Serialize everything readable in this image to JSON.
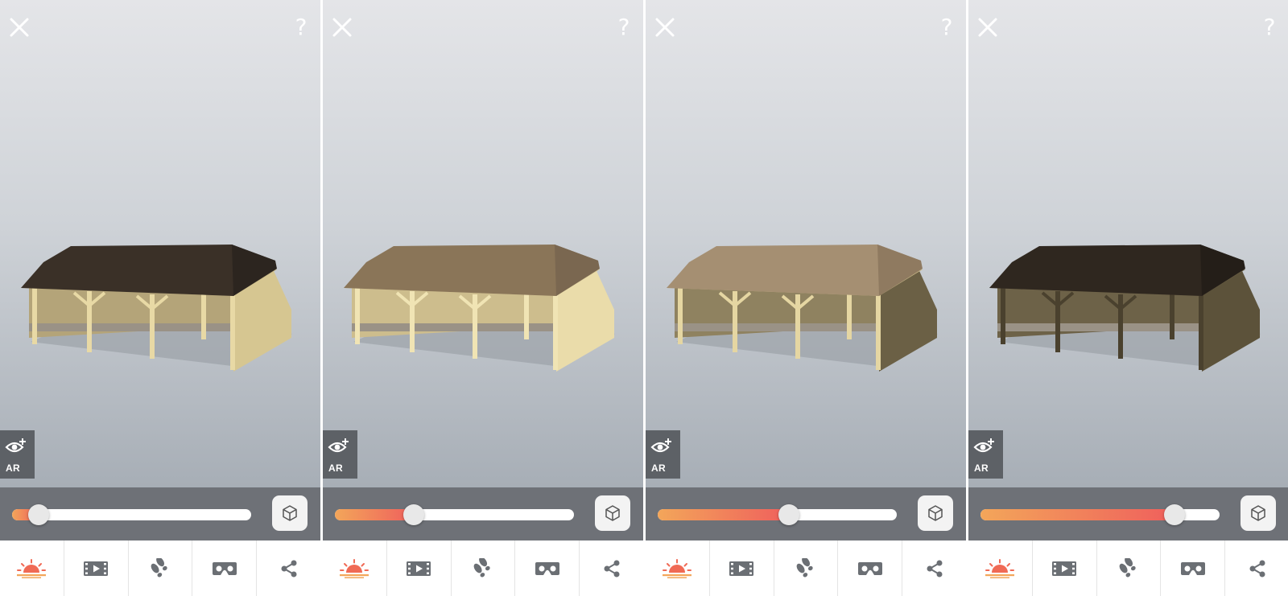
{
  "panels": [
    {
      "ar_label": "AR",
      "help_label": "?",
      "slider": {
        "value": 0.11
      },
      "lighting": "day"
    },
    {
      "ar_label": "AR",
      "help_label": "?",
      "slider": {
        "value": 0.33
      },
      "lighting": "bright"
    },
    {
      "ar_label": "AR",
      "help_label": "?",
      "slider": {
        "value": 0.55
      },
      "lighting": "afternoon"
    },
    {
      "ar_label": "AR",
      "help_label": "?",
      "slider": {
        "value": 0.81
      },
      "lighting": "dusk"
    }
  ],
  "tabs": [
    {
      "icon": "sunrise-icon",
      "active": true
    },
    {
      "icon": "film-icon",
      "active": false
    },
    {
      "icon": "footsteps-icon",
      "active": false
    },
    {
      "icon": "vr-headset-icon",
      "active": false
    },
    {
      "icon": "share-icon",
      "active": false
    }
  ],
  "colors": {
    "accent": "#f06a55",
    "slider_start": "#f3a65a",
    "slider_end": "#ef5f5c",
    "toolbar": "#6e7177",
    "icon": "#6b6f74"
  }
}
